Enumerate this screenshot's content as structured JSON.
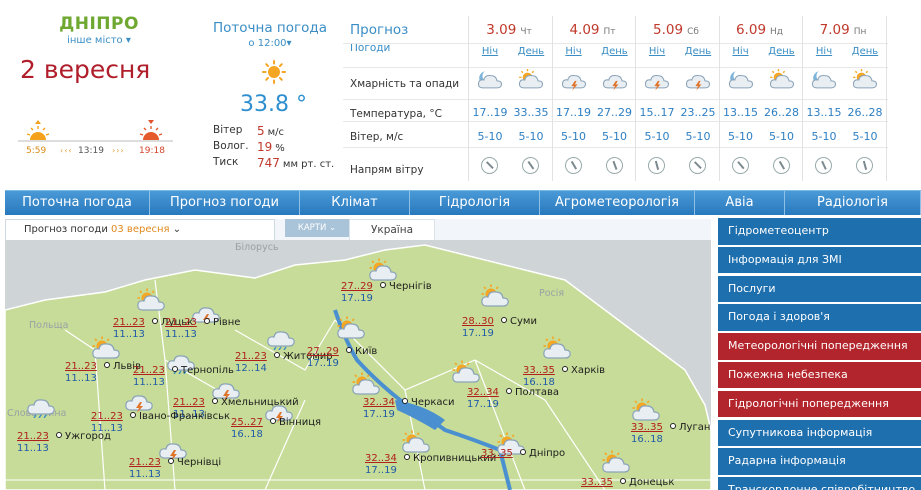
{
  "city": {
    "name": "ДНІПРО",
    "other_city": "інше місто",
    "date": "2 вересня"
  },
  "sun": {
    "sunrise": "5:59",
    "noon": "13:19",
    "sunset": "19:18"
  },
  "current": {
    "title": "Поточна погода",
    "time": "о 12:00",
    "temp": "33.8 °",
    "wind_label": "Вітер",
    "wind_value": "5",
    "wind_unit": "м/с",
    "humidity_label": "Волог.",
    "humidity_value": "19",
    "humidity_unit": "%",
    "pressure_label": "Тиск",
    "pressure_value": "747",
    "pressure_unit": "мм рт. ст."
  },
  "forecast": {
    "title": "Прогноз",
    "subtitle": "Погоди",
    "rows": {
      "clouds": "Хмарність та опади",
      "temp": "Температура, °C",
      "wind": "Вітер, м/с",
      "wind_dir": "Напрям вітру"
    },
    "night_label": "Ніч",
    "day_label": "День",
    "days": [
      {
        "date": "3.09",
        "dow": "Чт",
        "night_temp": "17..19",
        "day_temp": "33..35",
        "night_wind": "5-10",
        "day_wind": "5-10",
        "night_icon": "moon-cloud-icon",
        "day_icon": "sun-cloud-icon"
      },
      {
        "date": "4.09",
        "dow": "Пт",
        "night_temp": "17..19",
        "day_temp": "27..29",
        "night_wind": "5-10",
        "day_wind": "5-10",
        "night_icon": "cloud-lightning-icon",
        "day_icon": "cloud-lightning-icon"
      },
      {
        "date": "5.09",
        "dow": "Сб",
        "night_temp": "15..17",
        "day_temp": "23..25",
        "night_wind": "5-10",
        "day_wind": "5-10",
        "night_icon": "cloud-lightning-icon",
        "day_icon": "cloud-lightning-icon"
      },
      {
        "date": "6.09",
        "dow": "Нд",
        "night_temp": "13..15",
        "day_temp": "26..28",
        "night_wind": "5-10",
        "day_wind": "5-10",
        "night_icon": "moon-cloud-icon",
        "day_icon": "sun-cloud-icon"
      },
      {
        "date": "7.09",
        "dow": "Пн",
        "night_temp": "13..15",
        "day_temp": "26..28",
        "night_wind": "5-10",
        "day_wind": "5-10",
        "night_icon": "moon-cloud-icon",
        "day_icon": "sun-cloud-icon"
      }
    ]
  },
  "nav": [
    "Поточна погода",
    "Прогноз погоди",
    "Клімат",
    "Гідрологія",
    "Агрометеорологія",
    "Авіа",
    "Радіологія"
  ],
  "map_tabs": {
    "forecast_label": "Прогноз погоди",
    "forecast_date": "03 вересня",
    "maps_label": "КАРТИ",
    "region_label": "Україна"
  },
  "map_regions": [
    "Білорусь",
    "Росія",
    "Польща",
    "Словаччина"
  ],
  "map_cities": [
    {
      "name": "Луцьк",
      "day": "21..23",
      "night": "11..13",
      "icon": "sun-cloud-icon"
    },
    {
      "name": "Рівне",
      "day": "21..23",
      "night": "11..13",
      "icon": "cloud-lightning-icon"
    },
    {
      "name": "Львів",
      "day": "21..23",
      "night": "11..13",
      "icon": "sun-cloud-icon"
    },
    {
      "name": "Тернопіль",
      "day": "21..23",
      "night": "11..13",
      "icon": "cloud-rain-icon"
    },
    {
      "name": "Хмельницький",
      "day": "21..23",
      "night": "11..13",
      "icon": "cloud-lightning-icon"
    },
    {
      "name": "Житомир",
      "day": "21..23",
      "night": "12..14",
      "icon": "cloud-rain-icon"
    },
    {
      "name": "Київ",
      "day": "27..29",
      "night": "17..19",
      "icon": "sun-cloud-icon"
    },
    {
      "name": "Чернігів",
      "day": "27..29",
      "night": "17..19",
      "icon": "sun-cloud-icon"
    },
    {
      "name": "Суми",
      "day": "28..30",
      "night": "17..19",
      "icon": "sun-cloud-icon"
    },
    {
      "name": "Харків",
      "day": "33..35",
      "night": "16..18",
      "icon": "sun-cloud-icon"
    },
    {
      "name": "Полтава",
      "day": "32..34",
      "night": "17..19",
      "icon": "sun-cloud-icon"
    },
    {
      "name": "Черкаси",
      "day": "32..34",
      "night": "17..19",
      "icon": "sun-cloud-icon"
    },
    {
      "name": "Вінниця",
      "day": "25..27",
      "night": "16..18",
      "icon": "cloud-lightning-icon"
    },
    {
      "name": "Ужгород",
      "day": "21..23",
      "night": "11..13",
      "icon": "cloud-rain-icon"
    },
    {
      "name": "Івано-Франківськ",
      "day": "21..23",
      "night": "11..13",
      "icon": "cloud-lightning-icon"
    },
    {
      "name": "Чернівці",
      "day": "21..23",
      "night": "11..13",
      "icon": "cloud-lightning-icon"
    },
    {
      "name": "Кропивницький",
      "day": "32..34",
      "night": "17..19",
      "icon": "sun-cloud-icon"
    },
    {
      "name": "Дніпро",
      "day": "33..35",
      "night": "",
      "icon": "sun-cloud-icon"
    },
    {
      "name": "Луганськ",
      "day": "33..35",
      "night": "16..18",
      "icon": "sun-cloud-icon"
    },
    {
      "name": "Донецьк",
      "day": "33..35",
      "night": "",
      "icon": "sun-cloud-icon"
    }
  ],
  "sidebar": [
    {
      "label": "Гідрометеоцентр",
      "color": "#1e6fae"
    },
    {
      "label": "Інформація для ЗМІ",
      "color": "#1e6fae"
    },
    {
      "label": "Послуги",
      "color": "#1e6fae"
    },
    {
      "label": "Погода і здоров'я",
      "color": "#1e6fae"
    },
    {
      "label": "Метеорологічні попередження",
      "color": "#b3252c"
    },
    {
      "label": "Пожежна небезпека",
      "color": "#b3252c"
    },
    {
      "label": "Гідрологічні попередження",
      "color": "#b3252c"
    },
    {
      "label": "Супутникова інформація",
      "color": "#1e6fae"
    },
    {
      "label": "Радарна інформація",
      "color": "#1e6fae"
    },
    {
      "label": "Транскордонне співробітництво",
      "color": "#1e6fae"
    }
  ],
  "colors": {
    "accent_blue": "#3a8ec5",
    "city_green": "#6ea830",
    "date_red": "#b01e2b",
    "nav_blue": "#2878bd"
  }
}
